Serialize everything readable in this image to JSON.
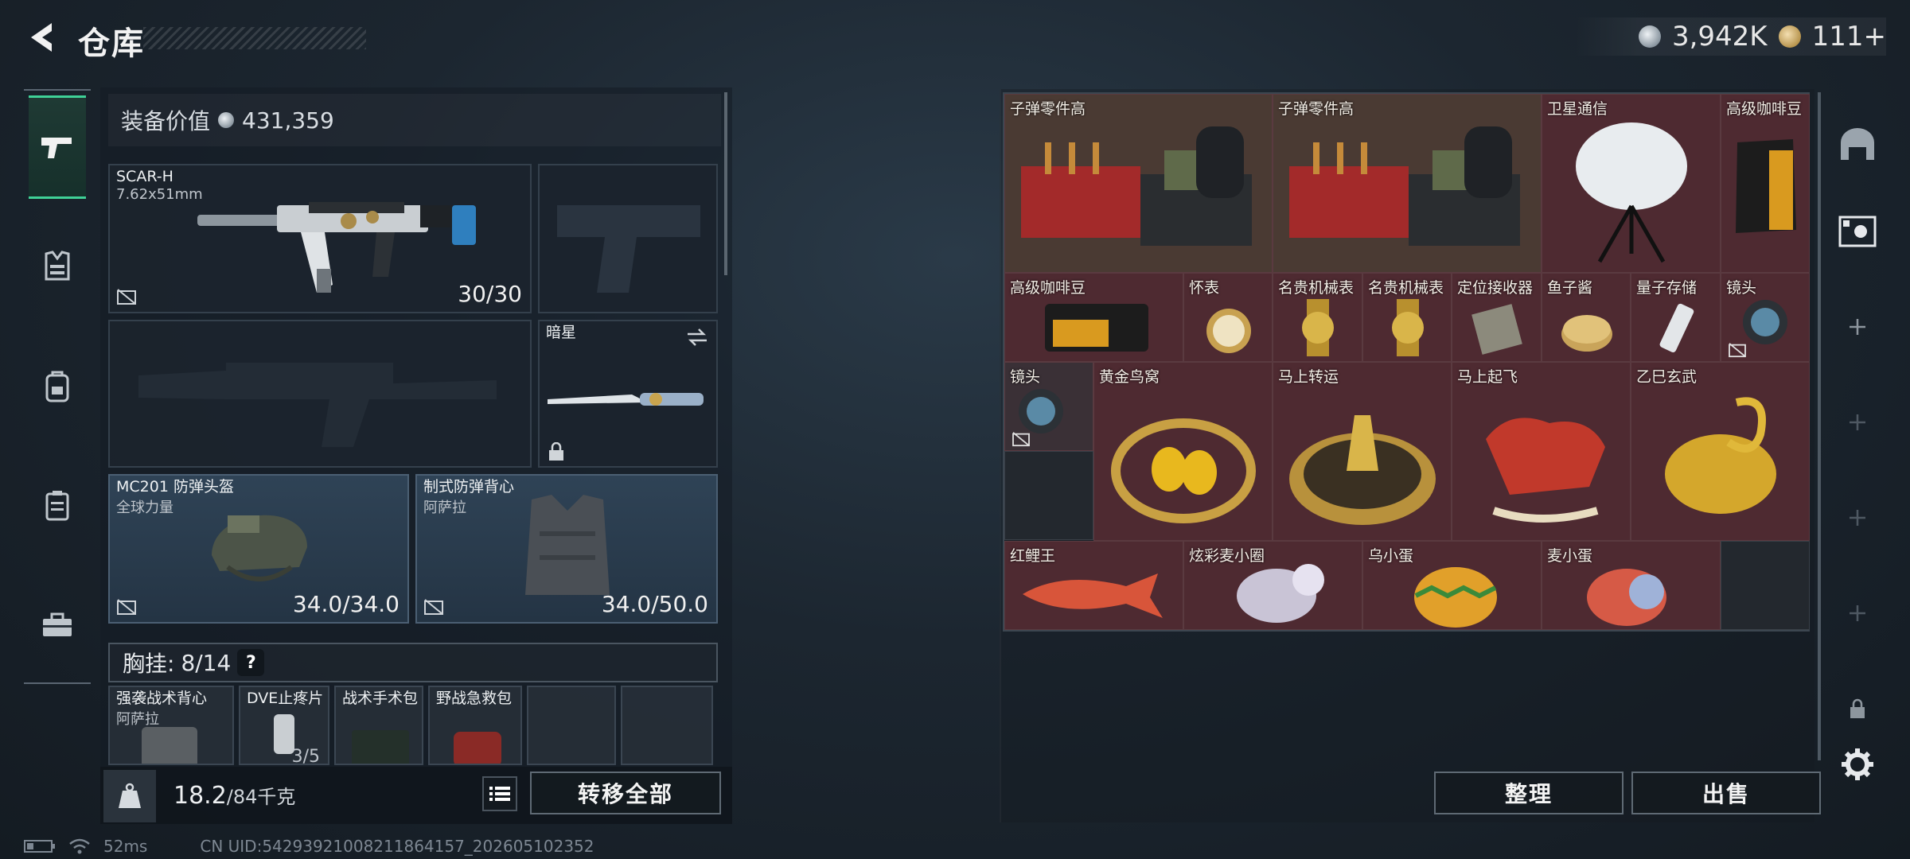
{
  "header": {
    "title": "仓库"
  },
  "currency": {
    "coins": "3,942K",
    "tickets": "111+"
  },
  "equipment": {
    "value_label": "装备价值",
    "value": "431,359",
    "primary_weapon": {
      "name": "SCAR-H",
      "ammo_type": "7.62x51mm",
      "ammo": "30/30"
    },
    "melee": {
      "name": "暗星"
    },
    "helmet": {
      "name": "MC201 防弹头盔",
      "faction": "全球力量",
      "durability": "34.0/34.0"
    },
    "armor": {
      "name": "制式防弹背心",
      "faction": "阿萨拉",
      "durability": "34.0/50.0"
    },
    "chest_rig": {
      "label": "胸挂:",
      "count": "8/14",
      "help": "?"
    },
    "chest_items": [
      {
        "name": "强袭战术背心",
        "sub": "阿萨拉"
      },
      {
        "name": "DVE止疼片",
        "sub": "3/5"
      },
      {
        "name": "战术手术包",
        "sub": ""
      },
      {
        "name": "野战急救包",
        "sub": ""
      }
    ]
  },
  "bottom_bar": {
    "weight": "18.2",
    "weight_max": "/84千克",
    "transfer_all": "转移全部",
    "sort": "整理",
    "sell": "出售"
  },
  "status": {
    "ping": "52ms",
    "uid": "CN UID:54293921008211864157_202605102352"
  },
  "storage_items": [
    {
      "name": "子弹零件高"
    },
    {
      "name": "子弹零件高"
    },
    {
      "name": "卫星通信"
    },
    {
      "name": "高级咖啡豆"
    },
    {
      "name": "高级咖啡豆"
    },
    {
      "name": "怀表"
    },
    {
      "name": "名贵机械表"
    },
    {
      "name": "名贵机械表"
    },
    {
      "name": "定位接收器"
    },
    {
      "name": "鱼子酱"
    },
    {
      "name": "量子存储"
    },
    {
      "name": "镜头"
    },
    {
      "name": "镜头"
    },
    {
      "name": "黄金鸟窝"
    },
    {
      "name": "马上转运"
    },
    {
      "name": "马上起飞"
    },
    {
      "name": "乙巳玄武"
    },
    {
      "name": "红鲤王"
    },
    {
      "name": "炫彩麦小圈"
    },
    {
      "name": "乌小蛋"
    },
    {
      "name": "麦小蛋"
    }
  ],
  "icons": {
    "back": "chevron-left-icon",
    "pistol": "pistol-icon",
    "vest": "vest-icon",
    "backpack": "backpack-icon",
    "case": "case-icon",
    "toolbox": "toolbox-icon",
    "settings": "gear-icon"
  }
}
